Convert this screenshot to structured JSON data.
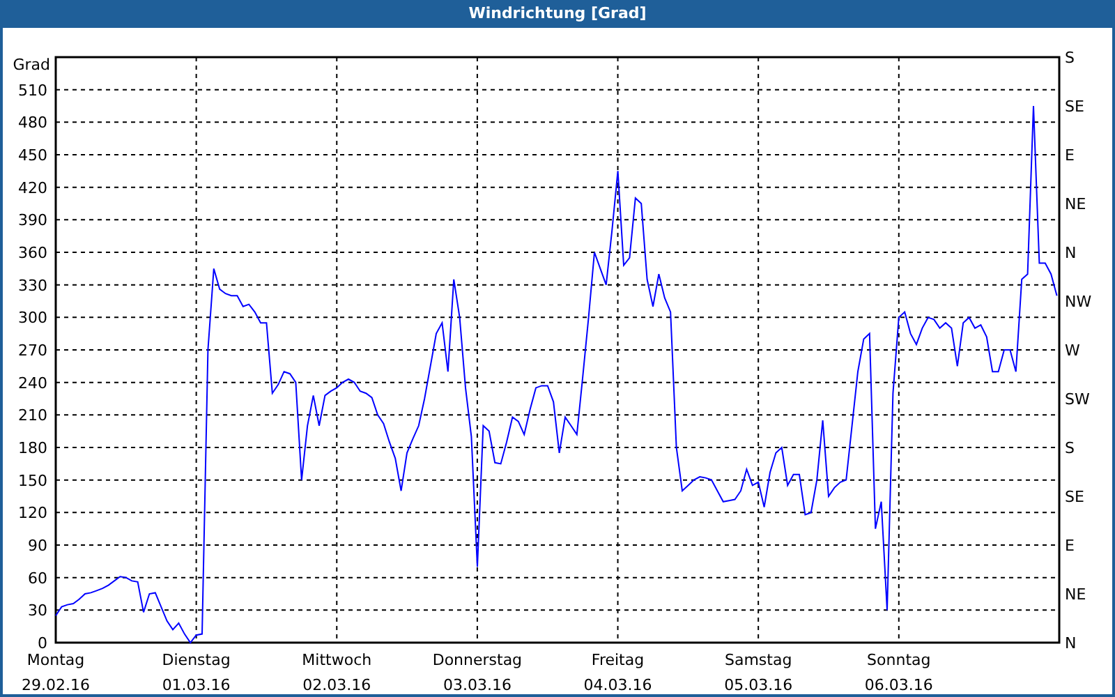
{
  "chart": {
    "chart_data": {
      "type": "line",
      "title": "Windrichtung [Grad]",
      "ylabel": "Grad",
      "ylim": [
        0,
        540
      ],
      "grid": true,
      "yticks": [
        0,
        30,
        60,
        90,
        120,
        150,
        180,
        210,
        240,
        270,
        300,
        330,
        360,
        390,
        420,
        450,
        480,
        510
      ],
      "categories": [
        "Montag 29.02.16",
        null,
        null,
        null,
        null,
        null,
        null,
        null,
        null,
        null,
        null,
        null,
        null,
        null,
        null,
        null,
        null,
        null,
        null,
        null,
        null,
        null,
        null,
        null,
        "Dienstag 01.03.16",
        null,
        null,
        null,
        null,
        null,
        null,
        null,
        null,
        null,
        null,
        null,
        null,
        null,
        null,
        null,
        null,
        null,
        null,
        null,
        null,
        null,
        null,
        null,
        "Mittwoch 02.03.16",
        null,
        null,
        null,
        null,
        null,
        null,
        null,
        null,
        null,
        null,
        null,
        null,
        null,
        null,
        null,
        null,
        null,
        null,
        null,
        null,
        null,
        null,
        null,
        "Donnerstag 03.03.16",
        null,
        null,
        null,
        null,
        null,
        null,
        null,
        null,
        null,
        null,
        null,
        null,
        null,
        null,
        null,
        null,
        null,
        null,
        null,
        null,
        null,
        null,
        null,
        "Freitag 04.03.16",
        null,
        null,
        null,
        null,
        null,
        null,
        null,
        null,
        null,
        null,
        null,
        null,
        null,
        null,
        null,
        null,
        null,
        null,
        null,
        null,
        null,
        null,
        null,
        "Samstag 05.03.16",
        null,
        null,
        null,
        null,
        null,
        null,
        null,
        null,
        null,
        null,
        null,
        null,
        null,
        null,
        null,
        null,
        null,
        null,
        null,
        null,
        null,
        null,
        null,
        "Sonntag 06.03.16",
        null,
        null,
        null,
        null,
        null,
        null,
        null,
        null,
        null,
        null,
        null,
        null,
        null,
        null,
        null,
        null,
        null,
        null,
        null,
        null,
        null,
        null,
        null,
        null,
        null,
        null,
        null
      ],
      "series": [
        {
          "color": "#0000ff",
          "values": [
            25,
            33,
            35,
            36,
            40,
            45,
            46,
            48,
            50,
            53,
            57,
            61,
            60,
            57,
            56,
            28,
            45,
            46,
            33,
            20,
            12,
            18,
            8,
            0,
            7,
            8,
            270,
            345,
            326,
            322,
            320,
            320,
            310,
            312,
            305,
            295,
            295,
            230,
            238,
            250,
            248,
            240,
            150,
            200,
            228,
            200,
            228,
            232,
            235,
            240,
            243,
            240,
            232,
            230,
            226,
            210,
            202,
            185,
            170,
            140,
            175,
            188,
            200,
            225,
            255,
            285,
            295,
            250,
            335,
            300,
            235,
            190,
            70,
            200,
            195,
            166,
            165,
            185,
            208,
            204,
            192,
            215,
            235,
            237,
            237,
            222,
            175,
            208,
            200,
            192,
            245,
            300,
            360,
            345,
            330,
            380,
            435,
            348,
            355,
            410,
            405,
            335,
            310,
            340,
            318,
            305,
            180,
            140,
            145,
            150,
            153,
            152,
            150,
            140,
            130,
            131,
            132,
            140,
            160,
            145,
            148,
            125,
            157,
            175,
            180,
            145,
            155,
            155,
            118,
            120,
            150,
            205,
            135,
            143,
            148,
            150,
            200,
            250,
            280,
            285,
            105,
            130,
            30,
            230,
            300,
            305,
            285,
            275,
            290,
            300,
            298,
            290,
            295,
            290,
            255,
            295,
            300,
            290,
            293,
            282,
            250,
            250,
            270,
            270,
            250,
            335,
            340,
            495,
            350,
            350,
            340,
            320
          ]
        }
      ]
    },
    "right_axis_labels": [
      "S",
      "SE",
      "E",
      "NE",
      "N",
      "NW",
      "W",
      "SW",
      "S",
      "SE",
      "E",
      "NE",
      "N"
    ]
  }
}
